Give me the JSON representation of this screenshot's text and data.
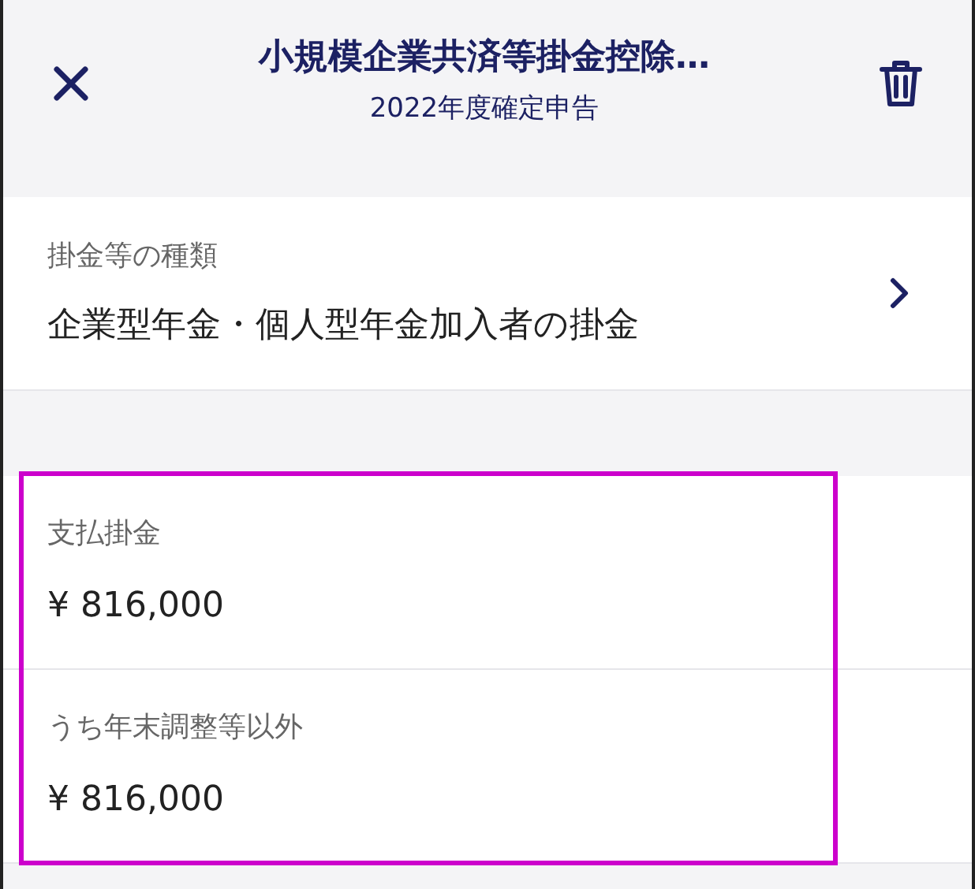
{
  "header": {
    "title": "小規模企業共済等掛金控除…",
    "subtitle": "2022年度確定申告"
  },
  "type_field": {
    "label": "掛金等の種類",
    "value": "企業型年金・個人型年金加入者の掛金"
  },
  "amounts": [
    {
      "label": "支払掛金",
      "value": "¥ 816,000"
    },
    {
      "label": "うち年末調整等以外",
      "value": "¥ 816,000"
    }
  ]
}
